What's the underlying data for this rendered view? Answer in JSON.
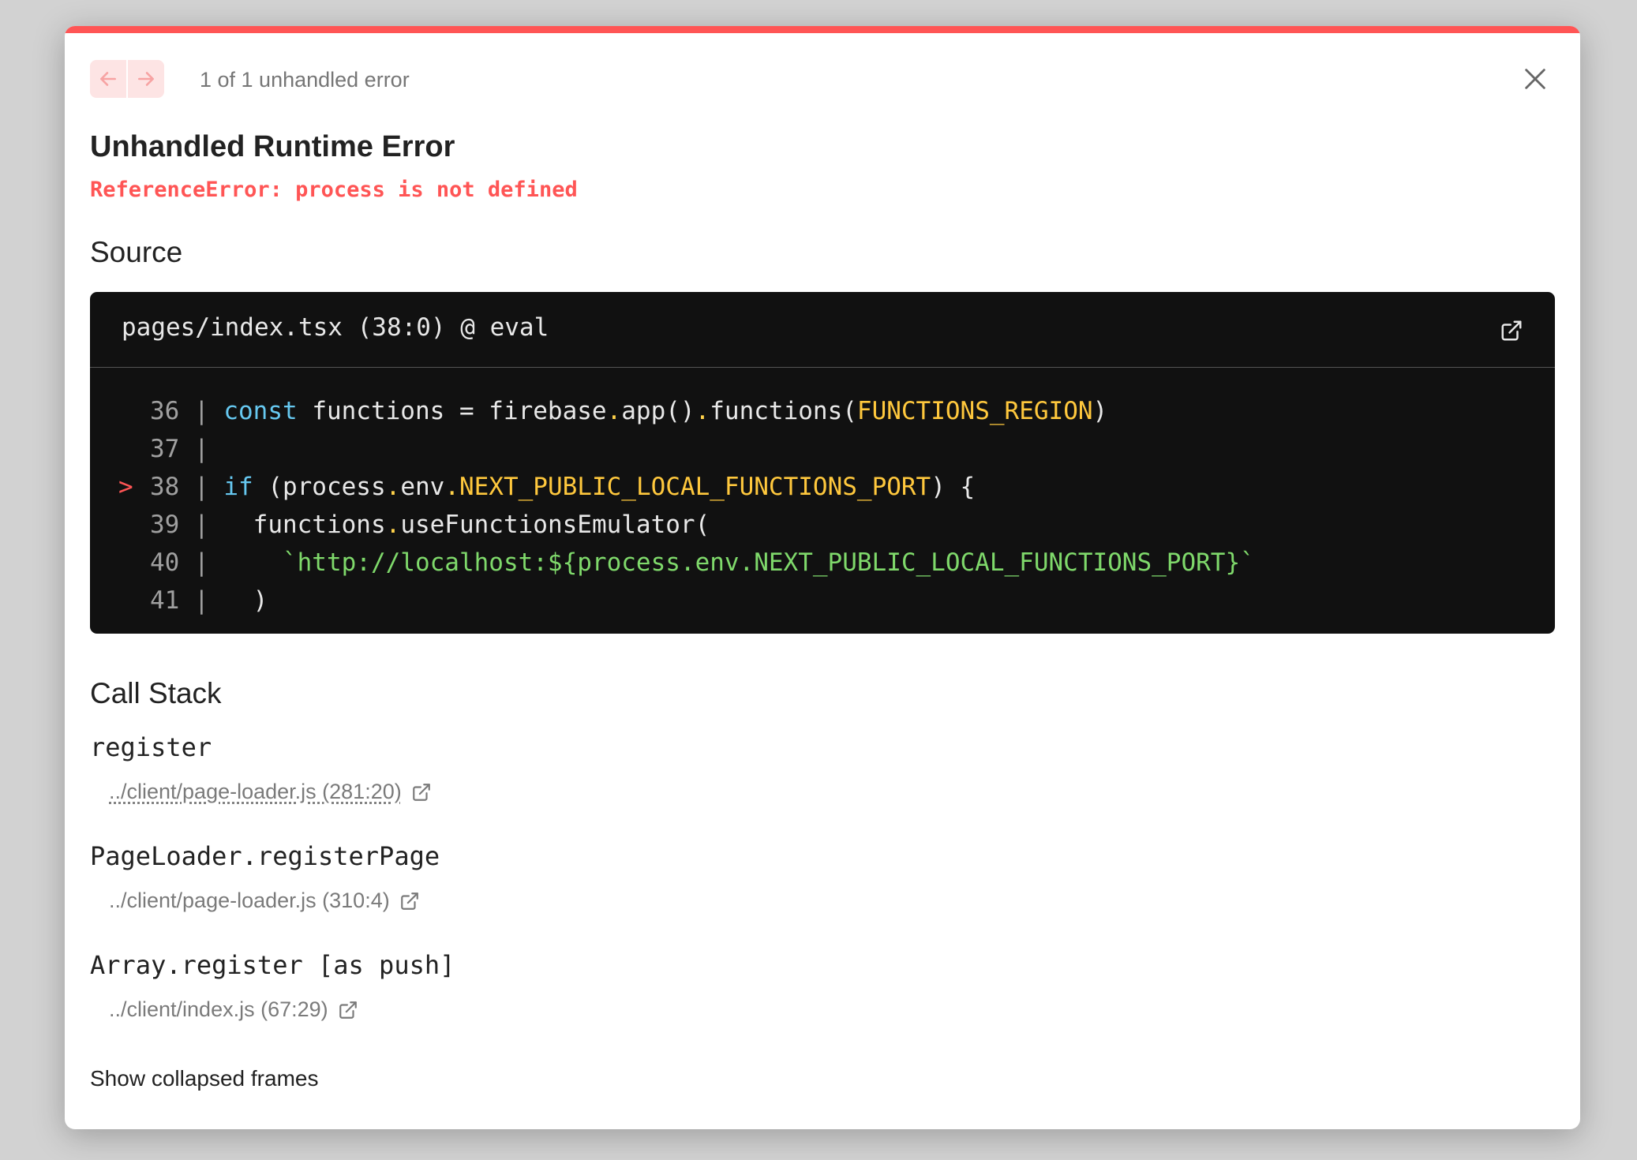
{
  "header": {
    "counter": "1 of 1 unhandled error",
    "prev_icon": "arrow-left-icon",
    "next_icon": "arrow-right-icon",
    "close_icon": "close-icon"
  },
  "error": {
    "title": "Unhandled Runtime Error",
    "message": "ReferenceError: process is not defined"
  },
  "source": {
    "heading": "Source",
    "file": "pages/index.tsx (38:0) @ eval",
    "lines": [
      {
        "num": "36",
        "marker": "",
        "code": "const functions = firebase.app().functions(FUNCTIONS_REGION)"
      },
      {
        "num": "37",
        "marker": "",
        "code": ""
      },
      {
        "num": "38",
        "marker": ">",
        "code": "if (process.env.NEXT_PUBLIC_LOCAL_FUNCTIONS_PORT) {"
      },
      {
        "num": "39",
        "marker": "",
        "code": "  functions.useFunctionsEmulator("
      },
      {
        "num": "40",
        "marker": "",
        "code": "    `http://localhost:${process.env.NEXT_PUBLIC_LOCAL_FUNCTIONS_PORT}`"
      },
      {
        "num": "41",
        "marker": "",
        "code": "  )"
      }
    ]
  },
  "call_stack": {
    "heading": "Call Stack",
    "frames": [
      {
        "fn": "register",
        "location": "../client/page-loader.js (281:20)"
      },
      {
        "fn": "PageLoader.registerPage",
        "location": "../client/page-loader.js (310:4)"
      },
      {
        "fn": "Array.register [as push]",
        "location": "../client/index.js (67:29)"
      }
    ],
    "show_collapsed": "Show collapsed frames"
  },
  "colors": {
    "accent": "#ff5555",
    "code_bg": "#111111",
    "keyword": "#66c8f0",
    "constant": "#ffc83d",
    "string": "#7fd96b"
  }
}
